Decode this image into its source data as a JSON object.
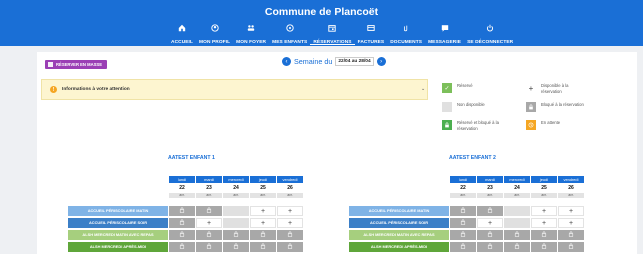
{
  "header": {
    "title": "Commune de Plancoët",
    "nav": [
      {
        "label": "ACCUEIL",
        "icon": "home-icon"
      },
      {
        "label": "MON PROFIL",
        "icon": "user-icon"
      },
      {
        "label": "MON FOYER",
        "icon": "household-icon"
      },
      {
        "label": "MES ENFANTS",
        "icon": "child-icon"
      },
      {
        "label": "RÉSERVATIONS",
        "icon": "calendar-icon",
        "active": true
      },
      {
        "label": "FACTURES",
        "icon": "invoice-icon"
      },
      {
        "label": "DOCUMENTS",
        "icon": "paperclip-icon"
      },
      {
        "label": "MESSAGERIE",
        "icon": "message-icon"
      },
      {
        "label": "SE DÉCONNECTER",
        "icon": "power-icon"
      }
    ]
  },
  "toolbar": {
    "mass_booking_label": "RÉSERVER EN MASSE",
    "week_label": "Semaine du",
    "week_range": "22/04 au 28/04",
    "prev_icon": "chevron-left-icon",
    "next_icon": "chevron-right-icon"
  },
  "info": {
    "text": "Informations à votre attention"
  },
  "legend": [
    {
      "label": "Réservé",
      "icon": "check-icon",
      "color": "#7cbf5a"
    },
    {
      "label": "Disponible à la réservation",
      "icon": "plus-icon",
      "color": "#ffffff"
    },
    {
      "label": "Non disponible",
      "icon": "none",
      "color": "#e0e0e0"
    },
    {
      "label": "Bloqué à la réservation",
      "icon": "lock-icon",
      "color": "#a8a8a8"
    },
    {
      "label": "Réservé et bloqué à la réservation",
      "icon": "lock-icon",
      "color": "#4caf50"
    },
    {
      "label": "En attente",
      "icon": "clock-icon",
      "color": "#f5a623"
    }
  ],
  "days": [
    {
      "name": "lundi",
      "num": "22",
      "month": "avr."
    },
    {
      "name": "mardi",
      "num": "23",
      "month": "avr."
    },
    {
      "name": "mercredi",
      "num": "24",
      "month": "avr."
    },
    {
      "name": "jeudi",
      "num": "25",
      "month": "avr."
    },
    {
      "name": "vendredi",
      "num": "26",
      "month": "avr."
    }
  ],
  "children": [
    {
      "name": "AATEST ENFANT 1",
      "rows": [
        {
          "label": "ACCUEIL PÉRISCOLAIRE MATIN",
          "color": "#7fb3e6",
          "cells": [
            "locked",
            "locked",
            "unavail",
            "avail",
            "avail"
          ]
        },
        {
          "label": "ACCUEIL PÉRISCOLAIRE SOIR",
          "color": "#3b7fc7",
          "cells": [
            "locked",
            "avail",
            "unavail",
            "avail",
            "avail"
          ]
        },
        {
          "label": "ALSH MERCREDI MATIN AVEC REPAS",
          "color": "#a6cf7e",
          "cells": [
            "locked",
            "locked",
            "locked",
            "locked",
            "locked"
          ]
        },
        {
          "label": "ALSH MERCREDI APRÈS-MIDI",
          "color": "#5fa63a",
          "cells": [
            "locked",
            "locked",
            "locked",
            "locked",
            "locked"
          ]
        }
      ]
    },
    {
      "name": "AATEST ENFANT 2",
      "rows": [
        {
          "label": "ACCUEIL PÉRISCOLAIRE MATIN",
          "color": "#7fb3e6",
          "cells": [
            "locked",
            "locked",
            "unavail",
            "avail",
            "avail"
          ]
        },
        {
          "label": "ACCUEIL PÉRISCOLAIRE SOIR",
          "color": "#3b7fc7",
          "cells": [
            "locked",
            "avail",
            "unavail",
            "avail",
            "avail"
          ]
        },
        {
          "label": "ALSH MERCREDI MATIN AVEC REPAS",
          "color": "#a6cf7e",
          "cells": [
            "locked",
            "locked",
            "locked",
            "locked",
            "locked"
          ]
        },
        {
          "label": "ALSH MERCREDI APRÈS-MIDI",
          "color": "#5fa63a",
          "cells": [
            "locked",
            "locked",
            "locked",
            "locked",
            "locked"
          ]
        }
      ]
    }
  ]
}
